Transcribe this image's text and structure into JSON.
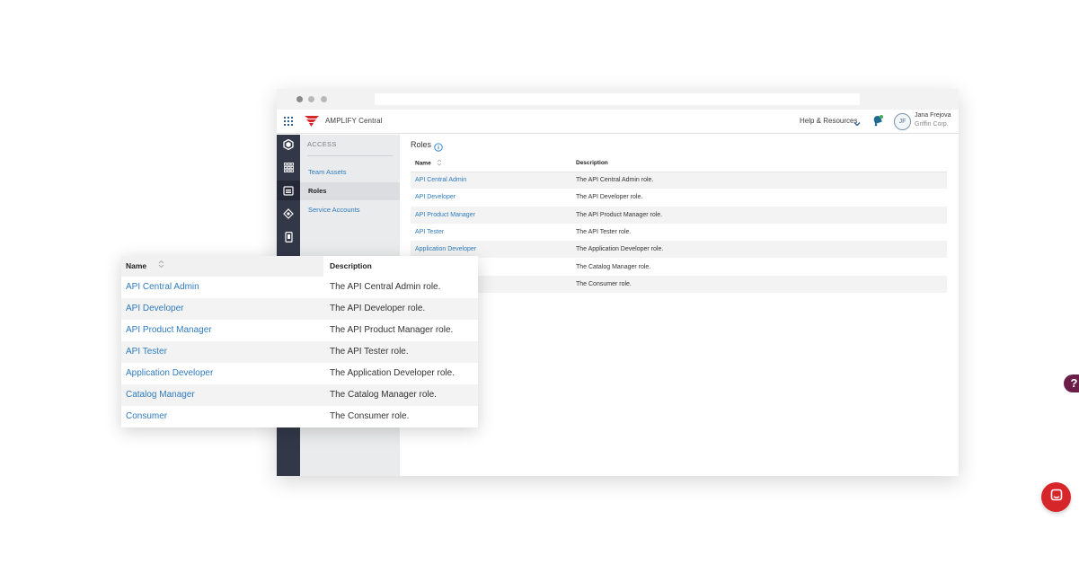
{
  "app": {
    "brand": "AMPLIFY Central",
    "help_label": "Help & Resources",
    "user_initials": "JF",
    "user_name": "Jana Frejova",
    "user_org": "Griffin Corp.",
    "accent_color": "#2f7bbf",
    "brand_color": "#d6262a"
  },
  "subnav": {
    "title": "ACCESS",
    "items": [
      {
        "label": "Team Assets",
        "active": false
      },
      {
        "label": "Roles",
        "active": true
      },
      {
        "label": "Service Accounts",
        "active": false
      }
    ]
  },
  "rail_icons": [
    "hexagon-logo-icon",
    "apps-grid-icon",
    "identity-card-icon",
    "topology-icon",
    "mobile-device-icon"
  ],
  "main": {
    "title": "Roles",
    "columns": [
      "Name",
      "Description"
    ],
    "rows": [
      {
        "name": "API Central Admin",
        "description": "The API Central Admin role."
      },
      {
        "name": "API Developer",
        "description": "The API Developer role."
      },
      {
        "name": "API Product Manager",
        "description": "The API Product Manager role."
      },
      {
        "name": "API Tester",
        "description": "The API Tester role."
      },
      {
        "name": "Application Developer",
        "description": "The Application Developer role."
      },
      {
        "name": "Catalog Manager",
        "description": "The Catalog Manager role."
      },
      {
        "name": "Consumer",
        "description": "The Consumer role."
      }
    ]
  },
  "help_bubble": "?"
}
